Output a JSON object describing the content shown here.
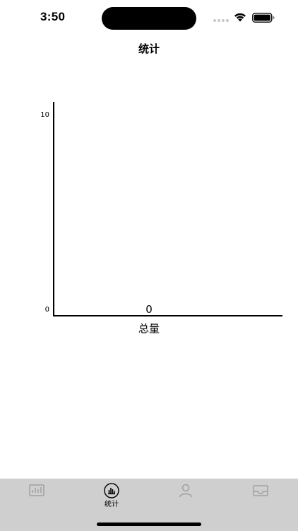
{
  "status_bar": {
    "time": "3:50"
  },
  "nav": {
    "title": "统计"
  },
  "tab_bar": {
    "items": [
      {
        "label": "",
        "icon": "dashboard-icon",
        "selected": false
      },
      {
        "label": "统计",
        "icon": "chart-icon",
        "selected": true
      },
      {
        "label": "",
        "icon": "users-icon",
        "selected": false
      },
      {
        "label": "",
        "icon": "inbox-icon",
        "selected": false
      }
    ]
  },
  "chart_data": {
    "type": "bar",
    "categories": [
      "总量"
    ],
    "values": [
      0
    ],
    "data_labels": [
      "0"
    ],
    "y_ticks": [
      "0",
      "10"
    ],
    "ylim": [
      0,
      10
    ],
    "title": "",
    "xlabel": "",
    "ylabel": "",
    "colors": {
      "axis": "#000000",
      "bar": "#000000"
    }
  }
}
